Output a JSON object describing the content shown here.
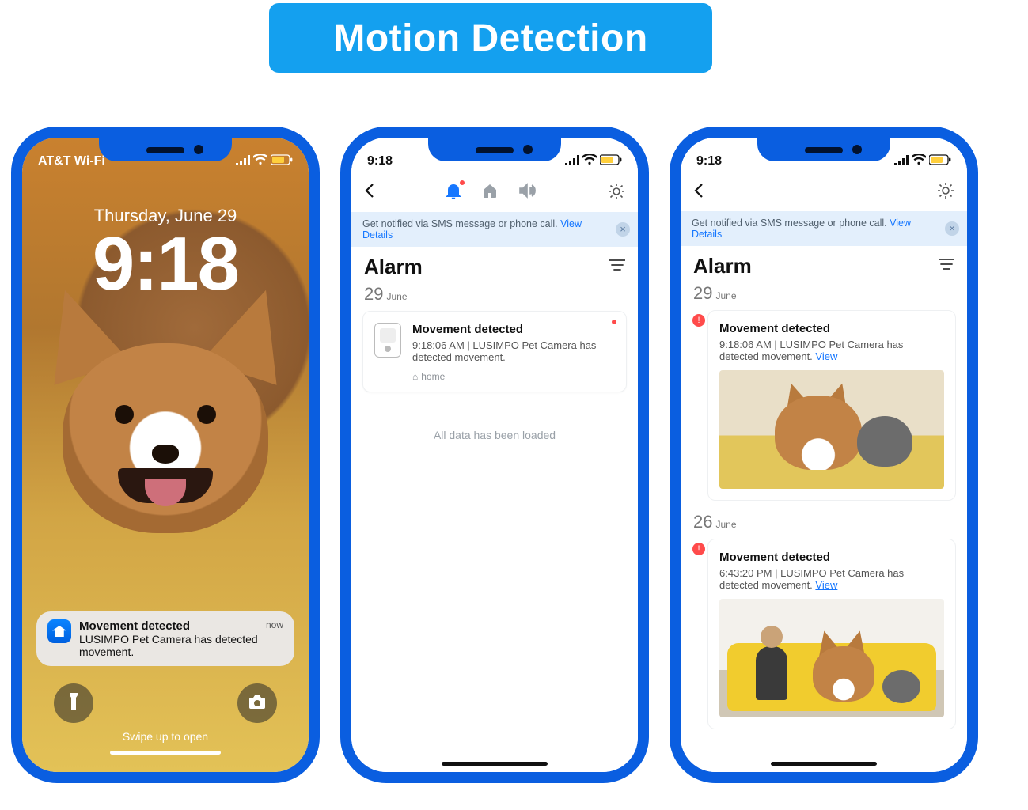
{
  "banner": {
    "title": "Motion Detection"
  },
  "status": {
    "carrier": "AT&T Wi-Fi",
    "time": "9:18"
  },
  "lockscreen": {
    "date": "Thursday, June 29",
    "time": "9:18",
    "notification": {
      "title": "Movement detected",
      "body": "LUSIMPO Pet Camera has detected movement.",
      "when": "now"
    },
    "swipe_hint": "Swipe up to open"
  },
  "sms_banner": {
    "text": "Get notified via SMS message or phone call.",
    "link": "View Details"
  },
  "alarm": {
    "title": "Alarm",
    "date_day": "29",
    "date_month": "June",
    "card": {
      "title": "Movement detected",
      "body": "9:18:06 AM | LUSIMPO Pet Camera has detected movement.",
      "home": "home"
    },
    "loaded_msg": "All data has been loaded"
  },
  "alarm2": {
    "title": "Alarm",
    "dates": [
      {
        "day": "29",
        "month": "June"
      },
      {
        "day": "26",
        "month": "June"
      }
    ],
    "cards": [
      {
        "title": "Movement detected",
        "body_prefix": "9:18:06 AM | LUSIMPO Pet Camera has detected movement. ",
        "view": "View"
      },
      {
        "title": "Movement detected",
        "body_prefix": "6:43:20 PM | LUSIMPO Pet Camera has detected movement. ",
        "view": "View"
      }
    ]
  }
}
